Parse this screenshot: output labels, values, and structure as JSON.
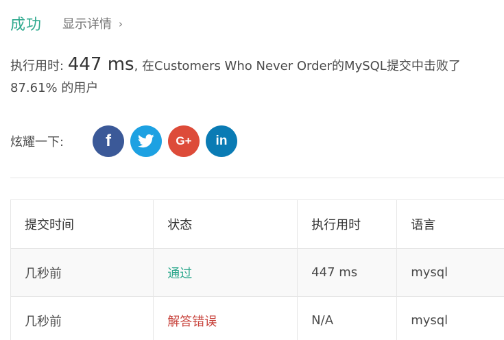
{
  "status": {
    "result": "成功",
    "details_link": "显示详情",
    "chevron": "›"
  },
  "summary": {
    "runtime_label": "执行用时:",
    "runtime_value": "447 ms",
    "rest": ", 在Customers Who Never Order的MySQL提交中击败了",
    "percentile": "87.61% 的用户"
  },
  "share": {
    "label": "炫耀一下:",
    "networks": [
      {
        "name": "facebook",
        "glyph": "f",
        "color": "#3b5998"
      },
      {
        "name": "twitter",
        "glyph": "twitter-bird",
        "color": "#1da1e2"
      },
      {
        "name": "google-plus",
        "glyph": "G+",
        "color": "#dd4b39"
      },
      {
        "name": "linkedin",
        "glyph": "in",
        "color": "#0a7bb4"
      }
    ]
  },
  "table": {
    "headers": [
      "提交时间",
      "状态",
      "执行用时",
      "语言"
    ],
    "rows": [
      {
        "time": "几秒前",
        "status": "通过",
        "runtime": "447 ms",
        "language": "mysql"
      },
      {
        "time": "几秒前",
        "status": "解答错误",
        "runtime": "N/A",
        "language": "mysql"
      }
    ]
  }
}
